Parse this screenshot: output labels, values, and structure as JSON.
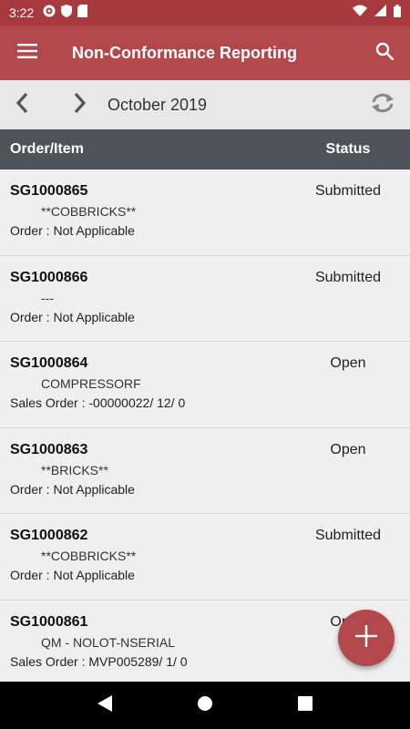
{
  "status_bar": {
    "time": "3:22",
    "left_icons": [
      "gear-icon",
      "shield-icon",
      "sd-card-icon"
    ],
    "right_icons": [
      "wifi-icon",
      "signal-icon",
      "battery-icon"
    ]
  },
  "app_bar": {
    "title": "Non-Conformance Reporting"
  },
  "month_bar": {
    "label": "October 2019"
  },
  "table": {
    "col_order": "Order/Item",
    "col_status": "Status"
  },
  "rows": [
    {
      "id": "SG1000865",
      "item": "**COBBRICKS**",
      "ref": "Order  :  Not Applicable",
      "status": "Submitted"
    },
    {
      "id": "SG1000866",
      "item": "---",
      "ref": "Order  :  Not Applicable",
      "status": "Submitted"
    },
    {
      "id": "SG1000864",
      "item": "COMPRESSORF",
      "ref": "Sales Order :  -00000022/ 12/ 0",
      "status": "Open"
    },
    {
      "id": "SG1000863",
      "item": "**BRICKS**",
      "ref": "Order  :  Not Applicable",
      "status": "Open"
    },
    {
      "id": "SG1000862",
      "item": "**COBBRICKS**",
      "ref": "Order  :  Not Applicable",
      "status": "Submitted"
    },
    {
      "id": "SG1000861",
      "item": "QM - NOLOT-NSERIAL",
      "ref": "Sales Order :  MVP005289/ 1/ 0",
      "status": "Open"
    }
  ],
  "colors": {
    "status_bar": "#a83a3f",
    "app_bar": "#b2474c",
    "header": "#4e5259",
    "fab": "#b2474c"
  }
}
